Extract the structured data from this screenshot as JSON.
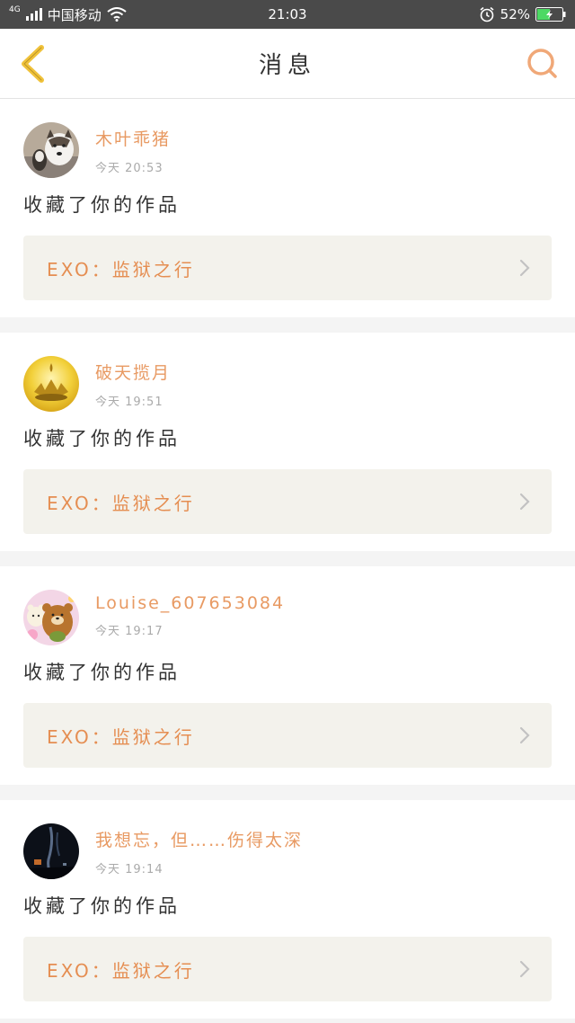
{
  "status_bar": {
    "network": "4G",
    "carrier": "中国移动",
    "time": "21:03",
    "battery": "52%",
    "battery_level": 0.52
  },
  "header": {
    "title": "消息"
  },
  "messages": [
    {
      "username": "木叶乖猪",
      "time": "今天 20:53",
      "action": "收藏了你的作品",
      "work_title": "EXO：监狱之行"
    },
    {
      "username": "破天揽月",
      "time": "今天 19:51",
      "action": "收藏了你的作品",
      "work_title": "EXO：监狱之行"
    },
    {
      "username": "Louise_607653084",
      "time": "今天 19:17",
      "action": "收藏了你的作品",
      "work_title": "EXO：监狱之行"
    },
    {
      "username": "我想忘，但……伤得太深",
      "time": "今天 19:14",
      "action": "收藏了你的作品",
      "work_title": "EXO：监狱之行"
    }
  ],
  "colors": {
    "accent": "#e89a63",
    "status_bar_bg": "#4a4a4a",
    "card_bg": "#f3f2ec",
    "back_icon": "#f0c23a",
    "battery_fill": "#4cd964"
  }
}
